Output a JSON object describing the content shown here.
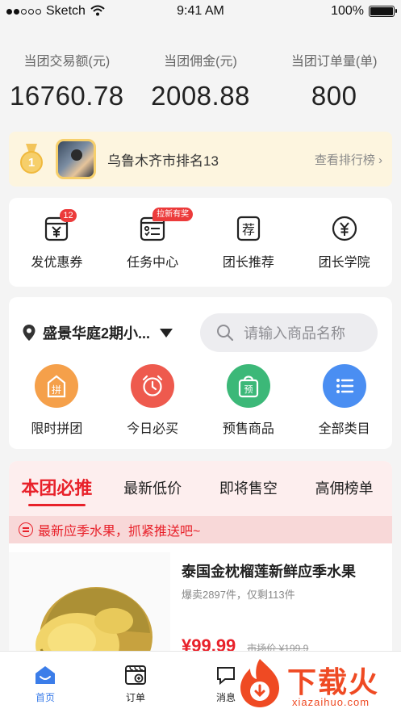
{
  "status_bar": {
    "carrier": "Sketch",
    "time": "9:41 AM",
    "battery": "100%",
    "battery_level": 1.0
  },
  "stats": [
    {
      "label": "当团交易额(元)",
      "value": "16760.78"
    },
    {
      "label": "当团佣金(元)",
      "value": "2008.88"
    },
    {
      "label": "当团订单量(单)",
      "value": "800"
    }
  ],
  "ranking": {
    "medal_number": "1",
    "text": "乌鲁木齐市排名13",
    "link": "查看排行榜 ›"
  },
  "tools": [
    {
      "label": "发优惠券",
      "icon": "coupon-yen-icon",
      "badge": "12"
    },
    {
      "label": "任务中心",
      "icon": "task-list-icon",
      "badge": "拉新有奖"
    },
    {
      "label": "团长推荐",
      "icon": "recommend-icon"
    },
    {
      "label": "团长学院",
      "icon": "academy-yen-icon"
    }
  ],
  "location": {
    "name": "盛景华庭2期小..."
  },
  "search": {
    "placeholder": "请输入商品名称"
  },
  "categories": [
    {
      "label": "限时拼团",
      "icon": "group-buy-icon",
      "color": "#f5a04a"
    },
    {
      "label": "今日必买",
      "icon": "alarm-clock-icon",
      "color": "#ee5a4e"
    },
    {
      "label": "预售商品",
      "icon": "presale-bag-icon",
      "color": "#3cb878"
    },
    {
      "label": "全部类目",
      "icon": "list-icon",
      "color": "#4a8ef2"
    }
  ],
  "tabs": [
    {
      "label": "本团必推",
      "active": true
    },
    {
      "label": "最新低价"
    },
    {
      "label": "即将售空"
    },
    {
      "label": "高佣榜单"
    }
  ],
  "notice": "最新应季水果，抓紧推送吧~",
  "product": {
    "title": "泰国金枕榴莲新鲜应季水果",
    "sales": "爆卖2897件，仅剩113件",
    "price": "¥99.99",
    "market_price": "市场价 ¥199.9"
  },
  "tabbar": [
    {
      "label": "首页",
      "icon": "home-icon",
      "active": true
    },
    {
      "label": "订单",
      "icon": "order-icon"
    },
    {
      "label": "消息",
      "icon": "message-icon"
    }
  ],
  "watermark": {
    "title": "下载火",
    "sub": "xiazaihuo.com"
  },
  "colors": {
    "accent_red": "#e8212a",
    "tab_blue": "#3b7de9"
  }
}
